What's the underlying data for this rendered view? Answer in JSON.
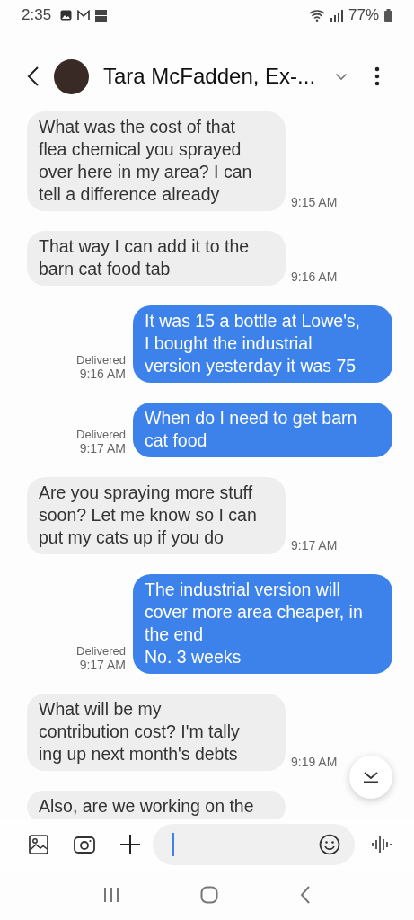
{
  "status_bar": {
    "time": "2:35",
    "battery": "77%"
  },
  "header": {
    "title": "Tara McFadden, Ex-..."
  },
  "messages": [
    {
      "kind": "received",
      "text": "What was the cost of that\nflea chemical you sprayed\nover here in my area? I can\ntell a difference already",
      "time": "9:15 AM"
    },
    {
      "kind": "received",
      "text": "That way I can add it to the\nbarn cat food tab",
      "time": "9:16 AM"
    },
    {
      "kind": "sent",
      "text": "It was 15 a bottle at Lowe's,\nI bought the industrial\nversion yesterday it was 75",
      "status": "Delivered",
      "time": "9:16 AM"
    },
    {
      "kind": "sent",
      "text": "When do I need to get barn\ncat food",
      "status": "Delivered",
      "time": "9:17 AM"
    },
    {
      "kind": "received",
      "text": "Are you spraying more stuff\nsoon? Let me know so I can\nput my cats up if you do",
      "time": "9:17 AM"
    },
    {
      "kind": "sent",
      "text": "The industrial version will\ncover more area cheaper, in\nthe end\nNo. 3 weeks",
      "status": "Delivered",
      "time": "9:17 AM"
    },
    {
      "kind": "received",
      "text": "What will be my\ncontribution cost? I'm tally\ning up next month's debts",
      "time": "9:19 AM"
    },
    {
      "kind": "received",
      "text": "Also, are we working on the"
    }
  ]
}
